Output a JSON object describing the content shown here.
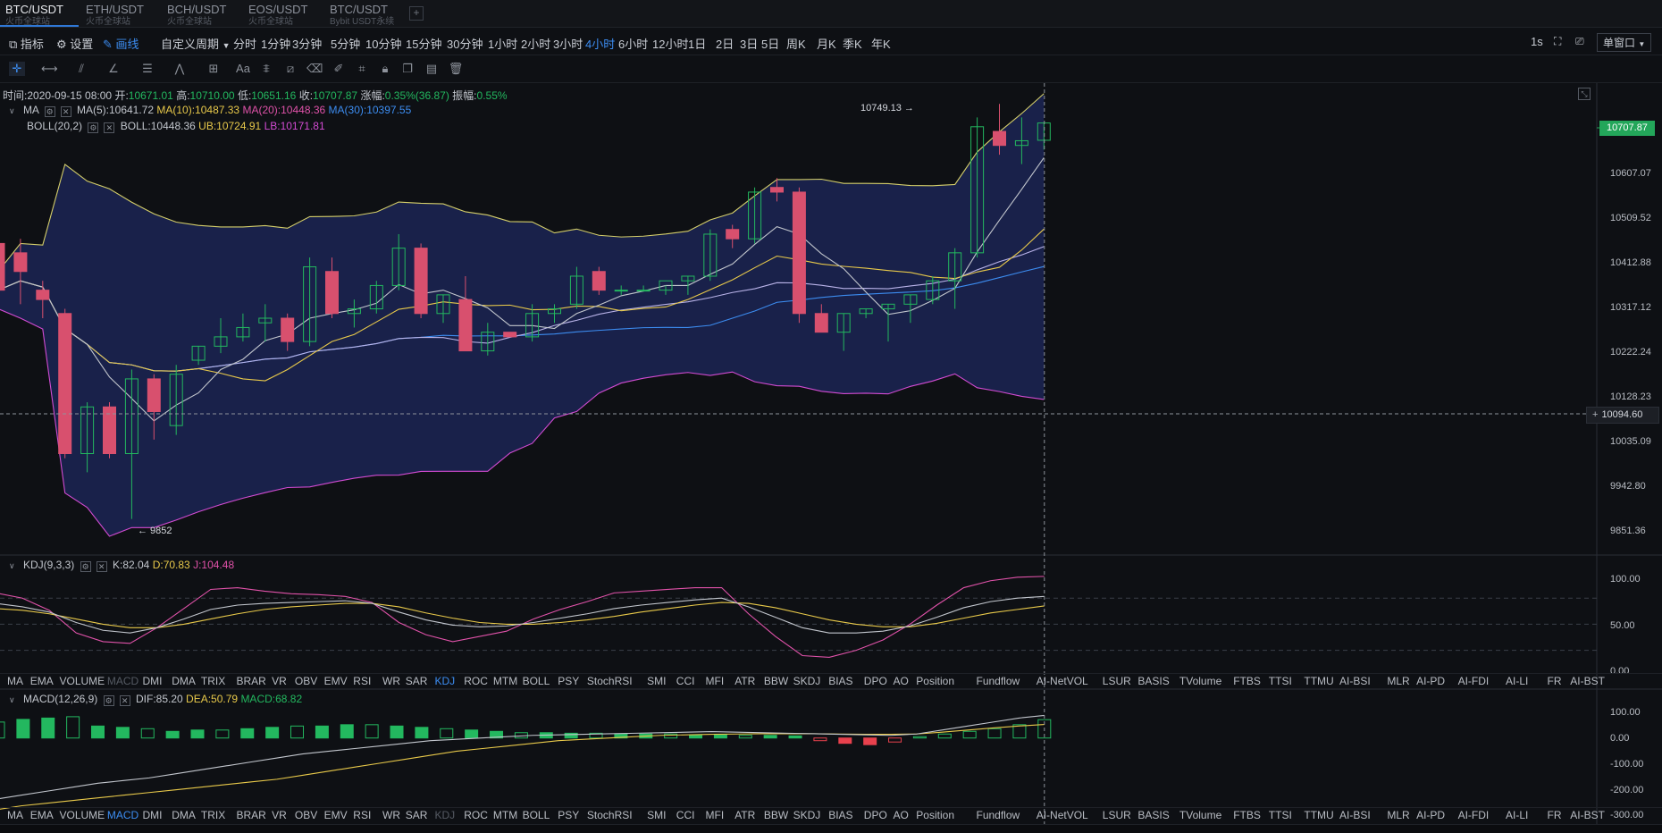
{
  "tabs": [
    {
      "symbol": "BTC/USDT",
      "venue": "火币全球站",
      "active": true
    },
    {
      "symbol": "ETH/USDT",
      "venue": "火币全球站"
    },
    {
      "symbol": "BCH/USDT",
      "venue": "火币全球站"
    },
    {
      "symbol": "EOS/USDT",
      "venue": "火币全球站"
    },
    {
      "symbol": "BTC/USDT",
      "venue": "Bybit USDT永续"
    }
  ],
  "toolbar": {
    "indicator": "指标",
    "settings": "设置",
    "draw": "画线",
    "custom_period": "自定义周期",
    "periods": [
      "分时",
      "1分钟",
      "3分钟",
      "5分钟",
      "10分钟",
      "15分钟",
      "30分钟",
      "1小时",
      "2小时",
      "3小时",
      "4小时",
      "6小时",
      "12小时",
      "1日",
      "2日",
      "3日",
      "5日",
      "周K",
      "月K",
      "季K",
      "年K"
    ],
    "active_period": "4小时",
    "refresh": "1s",
    "window_mode": "单窗口"
  },
  "ohlc": {
    "time_label": "时间:",
    "time": "2020-09-15 08:00",
    "open_label": "开:",
    "open": "10671.01",
    "high_label": "高:",
    "high": "10710.00",
    "low_label": "低:",
    "low": "10651.16",
    "close_label": "收:",
    "close": "10707.87",
    "change_label": "涨幅:",
    "change": "0.35%(36.87)",
    "amp_label": "振幅:",
    "amp": "0.55%"
  },
  "ma_legend": {
    "name": "MA",
    "ma5": "MA(5):10641.72",
    "ma10": "MA(10):10487.33",
    "ma20": "MA(20):10448.36",
    "ma30": "MA(30):10397.55"
  },
  "boll_legend": {
    "name": "BOLL(20,2)",
    "boll": "BOLL:10448.36",
    "ub": "UB:10724.91",
    "lb": "LB:10171.81"
  },
  "price_axis": [
    "10607.07",
    "10509.52",
    "10412.88",
    "10317.12",
    "10222.24",
    "10128.23",
    "10035.09",
    "9942.80",
    "9851.36"
  ],
  "last_price": "10707.87",
  "crosshair_price": "10094.60",
  "high_marker": "10749.13 →",
  "low_marker": "← 9852",
  "kdj_legend": {
    "name": "KDJ(9,3,3)",
    "k": "K:82.04",
    "d": "D:70.83",
    "j": "J:104.48"
  },
  "kdj_axis": [
    "100.00",
    "50.00",
    "0.00"
  ],
  "macd_legend": {
    "name": "MACD(12,26,9)",
    "dif": "DIF:85.20",
    "dea": "DEA:50.79",
    "macd": "MACD:68.82"
  },
  "macd_axis": [
    "100.00",
    "0.00",
    "-100.00",
    "-200.00",
    "-300.00"
  ],
  "indicators": [
    "MA",
    "EMA",
    "VOLUME",
    "MACD",
    "DMI",
    "DMA",
    "TRIX",
    "BRAR",
    "VR",
    "OBV",
    "EMV",
    "RSI",
    "WR",
    "SAR",
    "KDJ",
    "ROC",
    "MTM",
    "BOLL",
    "PSY",
    "StochRSI",
    "SMI",
    "CCI",
    "MFI",
    "ATR",
    "BBW",
    "SKDJ",
    "BIAS",
    "DPO",
    "AO",
    "Position",
    "Fundflow",
    "AI-NetVOL",
    "LSUR",
    "BASIS",
    "TVolume",
    "FTBS",
    "TTSI",
    "TTMU",
    "AI-BSI",
    "MLR",
    "AI-PD",
    "AI-FDI",
    "AI-LI",
    "FR",
    "AI-BST"
  ],
  "colors": {
    "up": "#23b85f",
    "down": "#e8414d",
    "boll_fill": "#1b2454",
    "ma5": "#c2c6cd",
    "ma10": "#e8c94a",
    "ma20": "#e052a9",
    "ma30": "#3c8cf0",
    "lb": "#d24bd2",
    "accent": "#2f78d6"
  },
  "chart_data": {
    "type": "candlestick",
    "candles": [
      {
        "o": 10450,
        "h": 10480,
        "l": 10090,
        "c": 10350
      },
      {
        "o": 10430,
        "h": 10460,
        "l": 10320,
        "c": 10390
      },
      {
        "o": 10350,
        "h": 10370,
        "l": 10290,
        "c": 10330
      },
      {
        "o": 10300,
        "h": 10310,
        "l": 9990,
        "c": 10000
      },
      {
        "o": 10000,
        "h": 10110,
        "l": 9960,
        "c": 10100
      },
      {
        "o": 10100,
        "h": 10110,
        "l": 9990,
        "c": 10000
      },
      {
        "o": 10000,
        "h": 10180,
        "l": 9860,
        "c": 10160
      },
      {
        "o": 10160,
        "h": 10170,
        "l": 10030,
        "c": 10090
      },
      {
        "o": 10060,
        "h": 10190,
        "l": 10040,
        "c": 10170
      },
      {
        "o": 10200,
        "h": 10230,
        "l": 10190,
        "c": 10230
      },
      {
        "o": 10230,
        "h": 10290,
        "l": 10215,
        "c": 10250
      },
      {
        "o": 10250,
        "h": 10300,
        "l": 10240,
        "c": 10270
      },
      {
        "o": 10280,
        "h": 10320,
        "l": 10240,
        "c": 10290
      },
      {
        "o": 10290,
        "h": 10300,
        "l": 10220,
        "c": 10240
      },
      {
        "o": 10240,
        "h": 10420,
        "l": 10230,
        "c": 10400
      },
      {
        "o": 10390,
        "h": 10420,
        "l": 10290,
        "c": 10300
      },
      {
        "o": 10300,
        "h": 10330,
        "l": 10270,
        "c": 10310
      },
      {
        "o": 10310,
        "h": 10370,
        "l": 10300,
        "c": 10360
      },
      {
        "o": 10360,
        "h": 10470,
        "l": 10350,
        "c": 10440
      },
      {
        "o": 10440,
        "h": 10450,
        "l": 10290,
        "c": 10300
      },
      {
        "o": 10300,
        "h": 10340,
        "l": 10280,
        "c": 10340
      },
      {
        "o": 10330,
        "h": 10380,
        "l": 10260,
        "c": 10220
      },
      {
        "o": 10220,
        "h": 10280,
        "l": 10210,
        "c": 10260
      },
      {
        "o": 10260,
        "h": 10260,
        "l": 10250,
        "c": 10250
      },
      {
        "o": 10250,
        "h": 10320,
        "l": 10240,
        "c": 10300
      },
      {
        "o": 10300,
        "h": 10320,
        "l": 10280,
        "c": 10310
      },
      {
        "o": 10320,
        "h": 10400,
        "l": 10310,
        "c": 10380
      },
      {
        "o": 10390,
        "h": 10400,
        "l": 10340,
        "c": 10350
      },
      {
        "o": 10350,
        "h": 10360,
        "l": 10340,
        "c": 10350
      },
      {
        "o": 10350,
        "h": 10360,
        "l": 10350,
        "c": 10350
      },
      {
        "o": 10350,
        "h": 10360,
        "l": 10340,
        "c": 10370
      },
      {
        "o": 10370,
        "h": 10380,
        "l": 10340,
        "c": 10380
      },
      {
        "o": 10380,
        "h": 10480,
        "l": 10370,
        "c": 10470
      },
      {
        "o": 10480,
        "h": 10490,
        "l": 10440,
        "c": 10460
      },
      {
        "o": 10460,
        "h": 10570,
        "l": 10450,
        "c": 10560
      },
      {
        "o": 10570,
        "h": 10590,
        "l": 10540,
        "c": 10560
      },
      {
        "o": 10560,
        "h": 10570,
        "l": 10280,
        "c": 10300
      },
      {
        "o": 10300,
        "h": 10320,
        "l": 10260,
        "c": 10260
      },
      {
        "o": 10260,
        "h": 10300,
        "l": 10220,
        "c": 10300
      },
      {
        "o": 10300,
        "h": 10310,
        "l": 10290,
        "c": 10310
      },
      {
        "o": 10310,
        "h": 10320,
        "l": 10240,
        "c": 10320
      },
      {
        "o": 10320,
        "h": 10340,
        "l": 10280,
        "c": 10340
      },
      {
        "o": 10330,
        "h": 10380,
        "l": 10320,
        "c": 10370
      },
      {
        "o": 10370,
        "h": 10440,
        "l": 10310,
        "c": 10430
      },
      {
        "o": 10430,
        "h": 10720,
        "l": 10420,
        "c": 10700
      },
      {
        "o": 10690,
        "h": 10749,
        "l": 10640,
        "c": 10660
      },
      {
        "o": 10660,
        "h": 10720,
        "l": 10620,
        "c": 10670
      },
      {
        "o": 10671,
        "h": 10710,
        "l": 10651,
        "c": 10708
      }
    ],
    "ylim": [
      9800,
      10780
    ],
    "kdj": {
      "k": [
        74,
        70,
        64,
        52,
        43,
        40,
        46,
        56,
        67,
        72,
        74,
        75,
        76,
        77,
        74,
        64,
        55,
        49,
        47,
        48,
        52,
        57,
        62,
        68,
        72,
        75,
        78,
        80,
        70,
        58,
        46,
        40,
        40,
        42,
        48,
        58,
        69,
        76,
        80,
        82
      ],
      "d": [
        68,
        66,
        62,
        56,
        50,
        46,
        46,
        50,
        56,
        62,
        67,
        70,
        72,
        74,
        74,
        70,
        63,
        57,
        52,
        50,
        50,
        52,
        55,
        59,
        64,
        68,
        72,
        75,
        74,
        69,
        62,
        55,
        50,
        47,
        47,
        51,
        57,
        63,
        67,
        71
      ],
      "j": [
        86,
        80,
        66,
        40,
        30,
        28,
        46,
        68,
        90,
        92,
        88,
        85,
        84,
        82,
        75,
        52,
        38,
        30,
        36,
        42,
        56,
        67,
        76,
        86,
        88,
        90,
        92,
        92,
        62,
        36,
        14,
        12,
        20,
        32,
        50,
        72,
        92,
        100,
        104,
        105
      ],
      "ylim": [
        -5,
        110
      ]
    },
    "macd": {
      "hist": [
        60,
        70,
        75,
        80,
        45,
        40,
        35,
        25,
        30,
        30,
        35,
        40,
        45,
        45,
        50,
        50,
        45,
        40,
        35,
        30,
        25,
        20,
        20,
        18,
        18,
        15,
        15,
        15,
        12,
        12,
        10,
        10,
        8,
        -10,
        -20,
        -25,
        -15,
        5,
        15,
        25,
        35,
        50,
        69
      ],
      "dif": [
        -230,
        -215,
        -200,
        -185,
        -170,
        -160,
        -150,
        -135,
        -120,
        -105,
        -90,
        -75,
        -60,
        -50,
        -40,
        -30,
        -20,
        -10,
        -5,
        0,
        5,
        10,
        12,
        14,
        16,
        18,
        20,
        22,
        24,
        22,
        20,
        18,
        16,
        14,
        12,
        10,
        15,
        30,
        45,
        60,
        75,
        85
      ],
      "dea": [
        -270,
        -255,
        -245,
        -235,
        -225,
        -215,
        -205,
        -195,
        -185,
        -175,
        -165,
        -155,
        -140,
        -125,
        -110,
        -95,
        -80,
        -65,
        -50,
        -40,
        -30,
        -20,
        -10,
        -5,
        0,
        5,
        10,
        12,
        14,
        15,
        16,
        16,
        16,
        15,
        14,
        14,
        15,
        22,
        30,
        38,
        45,
        51
      ],
      "ylim": [
        -310,
        120
      ]
    }
  }
}
